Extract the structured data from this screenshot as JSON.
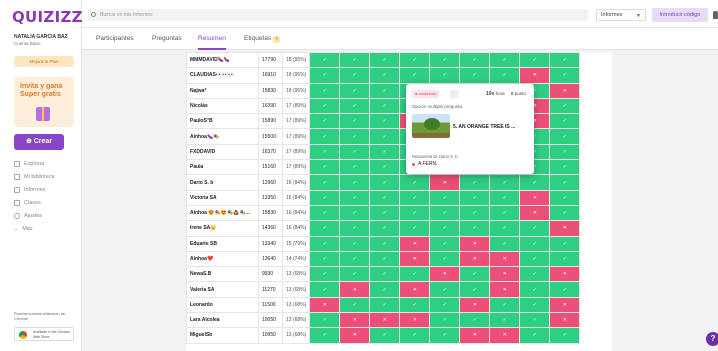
{
  "app": {
    "logo": "QUIZIZZ",
    "user_name": "NATALIA GARCIA BAZ",
    "user_plan": "Cuenta Basic",
    "upgrade_label": "Mejora tu Plan",
    "promo_text": "Invita y gana Super gratis",
    "create_label": "⊕ Crear",
    "nav": [
      {
        "label": "Explorar",
        "icon": "compass-icon"
      },
      {
        "label": "Mi biblioteca",
        "icon": "library-icon"
      },
      {
        "label": "Informes",
        "icon": "report-icon"
      },
      {
        "label": "Clases",
        "icon": "classes-icon"
      },
      {
        "label": "Ajustes",
        "icon": "gear-icon"
      },
      {
        "label": "Más",
        "icon": "chevron-down-icon"
      }
    ],
    "extension_text": "Prueba nuestra extensión de Chrome",
    "chrome_label": "Available in the Chrome Web Store"
  },
  "topbar": {
    "search_placeholder": "Buscar en mis Informes",
    "reports_select": "Informes",
    "join_label": "Introducir código"
  },
  "tabs": [
    {
      "label": "Participantes",
      "active": false
    },
    {
      "label": "Preguntas",
      "active": false
    },
    {
      "label": "Resumen",
      "active": true
    },
    {
      "label": "Etiquetas",
      "active": false,
      "badge": "+"
    }
  ],
  "table": {
    "mark_correct": "✓",
    "mark_wrong": "✕",
    "rows": [
      {
        "name": "MMMDAVID🍆🍆",
        "score": "17790",
        "acc": "18 (95%)",
        "answers": "ccccccccc"
      },
      {
        "name": "CLAUDIAS👀👀👀",
        "score": "16910",
        "acc": "18 (95%)",
        "answers": "cccccccwc"
      },
      {
        "name": "Najwa*",
        "score": "15830",
        "acc": "18 (95%)",
        "answers": "ccccccccw"
      },
      {
        "name": "Nicolás",
        "score": "16390",
        "acc": "17 (89%)",
        "answers": "cccccccwc"
      },
      {
        "name": "PauloS°B",
        "score": "15890",
        "acc": "17 (89%)",
        "answers": "cccwcccwc"
      },
      {
        "name": "Ainhoa🍆🎭",
        "score": "15500",
        "acc": "17 (89%)",
        "answers": "ccccccccc"
      },
      {
        "name": "FXDDAVID",
        "score": "16370",
        "acc": "17 (89%)",
        "answers": "ccccccccc"
      },
      {
        "name": "Paula",
        "score": "15160",
        "acc": "17 (89%)",
        "answers": "ccccccccc"
      },
      {
        "name": "Dario S. b",
        "score": "12960",
        "acc": "16 (84%)",
        "answers": "ccccwcccc"
      },
      {
        "name": "Victoria SA",
        "score": "13350",
        "acc": "16 (84%)",
        "answers": "cccccccwc"
      },
      {
        "name": "Ainhoa 😍🎭😍🎭💩🎭...",
        "score": "15830",
        "acc": "16 (84%)",
        "answers": "cccccccwc"
      },
      {
        "name": "Irene SA👑",
        "score": "14360",
        "acc": "16 (84%)",
        "answers": "ccccccccw"
      },
      {
        "name": "Eduarte SB",
        "score": "13340",
        "acc": "15 (79%)",
        "answers": "cccwcwccc"
      },
      {
        "name": "Ainhoa❤️",
        "score": "13640",
        "acc": "14 (74%)",
        "answers": "cccwcwwcc"
      },
      {
        "name": "NewaS.B",
        "score": "9930",
        "acc": "13 (68%)",
        "answers": "ccccwcwcw"
      },
      {
        "name": "Valeria SA",
        "score": "11270",
        "acc": "13 (68%)",
        "answers": "cwcwccwcc"
      },
      {
        "name": "Leonardo",
        "score": "11500",
        "acc": "13 (68%)",
        "answers": "wccccwccw"
      },
      {
        "name": "Lara Alcolea",
        "score": "10050",
        "acc": "13 (68%)",
        "answers": "cwwwccccw"
      },
      {
        "name": "MiguelSb",
        "score": "10950",
        "acc": "13 (68%)",
        "answers": "cwcccwwcc"
      }
    ]
  },
  "popup": {
    "badge": "● Incorrecto",
    "time_value": "10s",
    "time_unit": "hora",
    "points_value": "0",
    "points_unit": "punto",
    "question_type": "Opción multiple pregunta",
    "question_text": "5. AN ORANGE TREE IS ...",
    "response_label": "Respuesta de Dario S. b",
    "answer": "A FERN."
  },
  "colors": {
    "correct": "#2ecf83",
    "wrong": "#ec4f78",
    "accent": "#8a45c7"
  }
}
